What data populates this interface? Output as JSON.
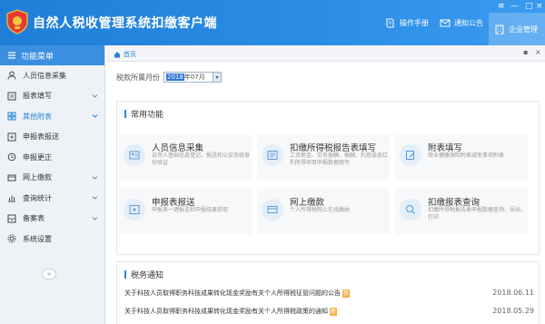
{
  "header": {
    "title": "自然人税收管理系统扣缴客户端",
    "buttons": [
      {
        "label": "操作手册",
        "icon": "book-icon"
      },
      {
        "label": "通知公告",
        "icon": "mail-icon"
      },
      {
        "label": "企业管理",
        "icon": "building-icon"
      }
    ]
  },
  "sidebar": {
    "title": "功能菜单",
    "items": [
      {
        "label": "人员信息采集",
        "icon": "person-icon",
        "expandable": false,
        "active": false
      },
      {
        "label": "报表填写",
        "icon": "form-icon",
        "expandable": true,
        "active": false
      },
      {
        "label": "其他附表",
        "icon": "grid-icon",
        "expandable": true,
        "active": true
      },
      {
        "label": "申报表报送",
        "icon": "send-icon",
        "expandable": false,
        "active": false
      },
      {
        "label": "申报更正",
        "icon": "search-icon",
        "expandable": false,
        "active": false
      },
      {
        "label": "网上缴款",
        "icon": "card-icon",
        "expandable": true,
        "active": false
      },
      {
        "label": "查询统计",
        "icon": "chart-icon",
        "expandable": true,
        "active": false
      },
      {
        "label": "备案表",
        "icon": "archive-icon",
        "expandable": true,
        "active": false
      },
      {
        "label": "系统设置",
        "icon": "gear-icon",
        "expandable": false,
        "active": false
      }
    ]
  },
  "tabs": {
    "home": "首页"
  },
  "period": {
    "label": "税款所属月份",
    "value_selected": "2018",
    "value_rest": "年07月"
  },
  "common_functions": {
    "title": "常用功能",
    "items": [
      {
        "name": "人员信息采集",
        "desc": "自然人基础信息登记、报送和公安系统身份验证"
      },
      {
        "name": "扣缴所得税报告表填写",
        "desc": "工资薪金、劳务报酬、稿酬、利息股息红利所得项目申报数据填写"
      },
      {
        "name": "附表填写",
        "desc": "商业健康保险附表减免事项附表"
      },
      {
        "name": "申报表报送",
        "desc": "申报表一键报送和申报结果获取"
      },
      {
        "name": "网上缴款",
        "desc": "个人所得税网上在线缴纳"
      },
      {
        "name": "扣缴报表查询",
        "desc": "扣缴所得税报告表申报数据查询、导出、打印"
      }
    ]
  },
  "tax_notices": {
    "title": "税务通知",
    "new_label": "新",
    "items": [
      {
        "text": "关于科技人员取得职务科技成果转化现金奖励有关个人所得税征管问题的公告",
        "date": "2018.06.11"
      },
      {
        "text": "关于科技人员取得职务科技成果转化现金奖励有关个人所得税政策的通知",
        "date": "2018.05.29"
      }
    ]
  }
}
